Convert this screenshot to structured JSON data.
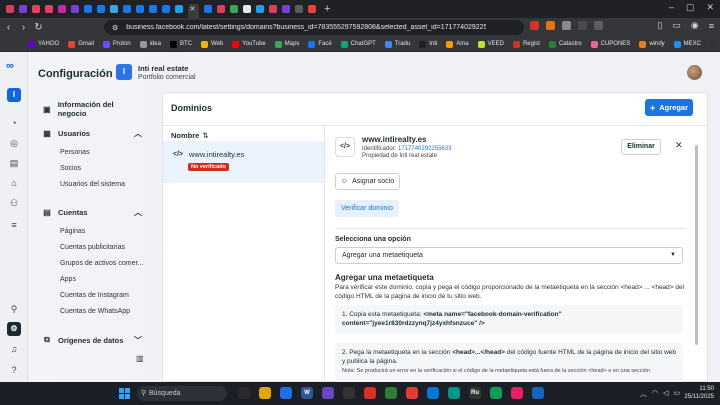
{
  "browser": {
    "url": "business.facebook.com/latest/settings/domains?business_id=783555297592808&selected_asset_id=1717740292255...",
    "tab_colors": [
      "#d93f5c",
      "#7b3fd9",
      "#e4405f",
      "#e4405f",
      "#c32aa3",
      "#7b3fd9",
      "#1877f2",
      "#1877f2",
      "#3ca6e8",
      "#1877f2",
      "#1877f2",
      "#1877f2",
      "#1877f2",
      "#1da1f2",
      "#1877f2",
      "#1877f2",
      "#d93f5c",
      "#34a853",
      "#e8e8e8",
      "#1da1f2",
      "#d93f5c",
      "#7b3fd9",
      "#5d5d5d",
      "#ea4335"
    ],
    "bookmarks": [
      {
        "label": "YAHOO",
        "color": "#6001d2"
      },
      {
        "label": "Gmail",
        "color": "#ea4335"
      },
      {
        "label": "Proton",
        "color": "#6d4aff"
      },
      {
        "label": "idea",
        "color": "#999999"
      },
      {
        "label": "BTC",
        "color": "#000000"
      },
      {
        "label": "Web",
        "color": "#f4b400"
      },
      {
        "label": "YouTube",
        "color": "#ff0000"
      },
      {
        "label": "Maps",
        "color": "#34a853"
      },
      {
        "label": "Facé",
        "color": "#1877f2"
      },
      {
        "label": "ChatGPT",
        "color": "#10a37f"
      },
      {
        "label": "Tradu",
        "color": "#4285f4"
      },
      {
        "label": "Inti",
        "color": "#222222"
      },
      {
        "label": "Ama",
        "color": "#ff9900"
      },
      {
        "label": "VEED",
        "color": "#b8e62e"
      },
      {
        "label": "Regist",
        "color": "#c0392b"
      },
      {
        "label": "Catastro",
        "color": "#2e7d32"
      },
      {
        "label": "CUPONES",
        "color": "#f06292"
      },
      {
        "label": "windy",
        "color": "#e67e22"
      },
      {
        "label": "MEXC",
        "color": "#1f8ef1"
      },
      {
        "label": "CWN",
        "color": "#333333"
      }
    ]
  },
  "header": {
    "title": "Configuración",
    "business_initial": "I",
    "business_name": "Inti real estate",
    "business_sub": "Portfolio comercial"
  },
  "sidebar": {
    "info": "Información del negocio",
    "usuarios": {
      "label": "Usuarios",
      "items": [
        "Personas",
        "Socios",
        "Usuarios del sistema"
      ]
    },
    "cuentas": {
      "label": "Cuentas",
      "items": [
        "Páginas",
        "Cuentas publicitarias",
        "Grupos de activos comer...",
        "Apps",
        "Cuentas de Instagram",
        "Cuentas de WhatsApp"
      ]
    },
    "origenes": {
      "label": "Orígenes de datos"
    }
  },
  "panel": {
    "title": "Dominios",
    "add_label": "Agregar",
    "column": "Nombre",
    "sort_glyph": "⇅",
    "domain": "www.intirealty.es",
    "badge": "No verificado"
  },
  "detail": {
    "title": "www.intirealty.es",
    "id_label": "Identificador:",
    "id_value": "1717740292255633",
    "property": "Propiedad de Inti real estate",
    "remove": "Eliminar",
    "assign": "Asignar socio",
    "verify": "Verificar dominio",
    "option_label": "Selecciona una opción",
    "select_value": "Agregar una metaetiqueta",
    "section_title": "Agregar una metaetiqueta",
    "section_desc": "Para verificar este dominio, copia y pega el código proporcionado de la metaetiqueta en la sección <head> ... <head> del código HTML de la página de inicio de tu sitio web.",
    "step1_prefix": "1. Copia esta metaetiqueta: ",
    "step1_code": "<meta name=\"facebook-domain-verification\" content=\"jyee1r830rdzzynq7jz4yxhfsnzuce\" />",
    "step2_prefix": "2. Pega la metaetiqueta en la sección ",
    "step2_code": "<head>...</head>",
    "step2_suffix": " del código fuente HTML de la página de inicio del sitio web y publica la página.",
    "step2_note": "Nota: Se producirá un error en la verificación si el código de la metaetiqueta está fuera de la sección <head> o en una sección"
  },
  "taskbar": {
    "search": "Búsqueda",
    "apps": [
      {
        "label": "",
        "color": "#2b2b2b"
      },
      {
        "label": "",
        "color": "#e0a800"
      },
      {
        "label": "",
        "color": "#1f6feb"
      },
      {
        "label": "W",
        "color": "#2b5797"
      },
      {
        "label": "",
        "color": "#6b46c1"
      },
      {
        "label": "",
        "color": "#333333"
      },
      {
        "label": "",
        "color": "#d93025"
      },
      {
        "label": "",
        "color": "#2e7d32"
      },
      {
        "label": "",
        "color": "#e53935"
      },
      {
        "label": "",
        "color": "#0078d4"
      },
      {
        "label": "",
        "color": "#009688"
      },
      {
        "label": "Ru",
        "color": "#333333"
      },
      {
        "label": "",
        "color": "#0f9d58"
      },
      {
        "label": "",
        "color": "#e91e63"
      },
      {
        "label": "",
        "color": "#1565c0"
      }
    ],
    "time": "11:50",
    "date": "25/11/2025"
  }
}
